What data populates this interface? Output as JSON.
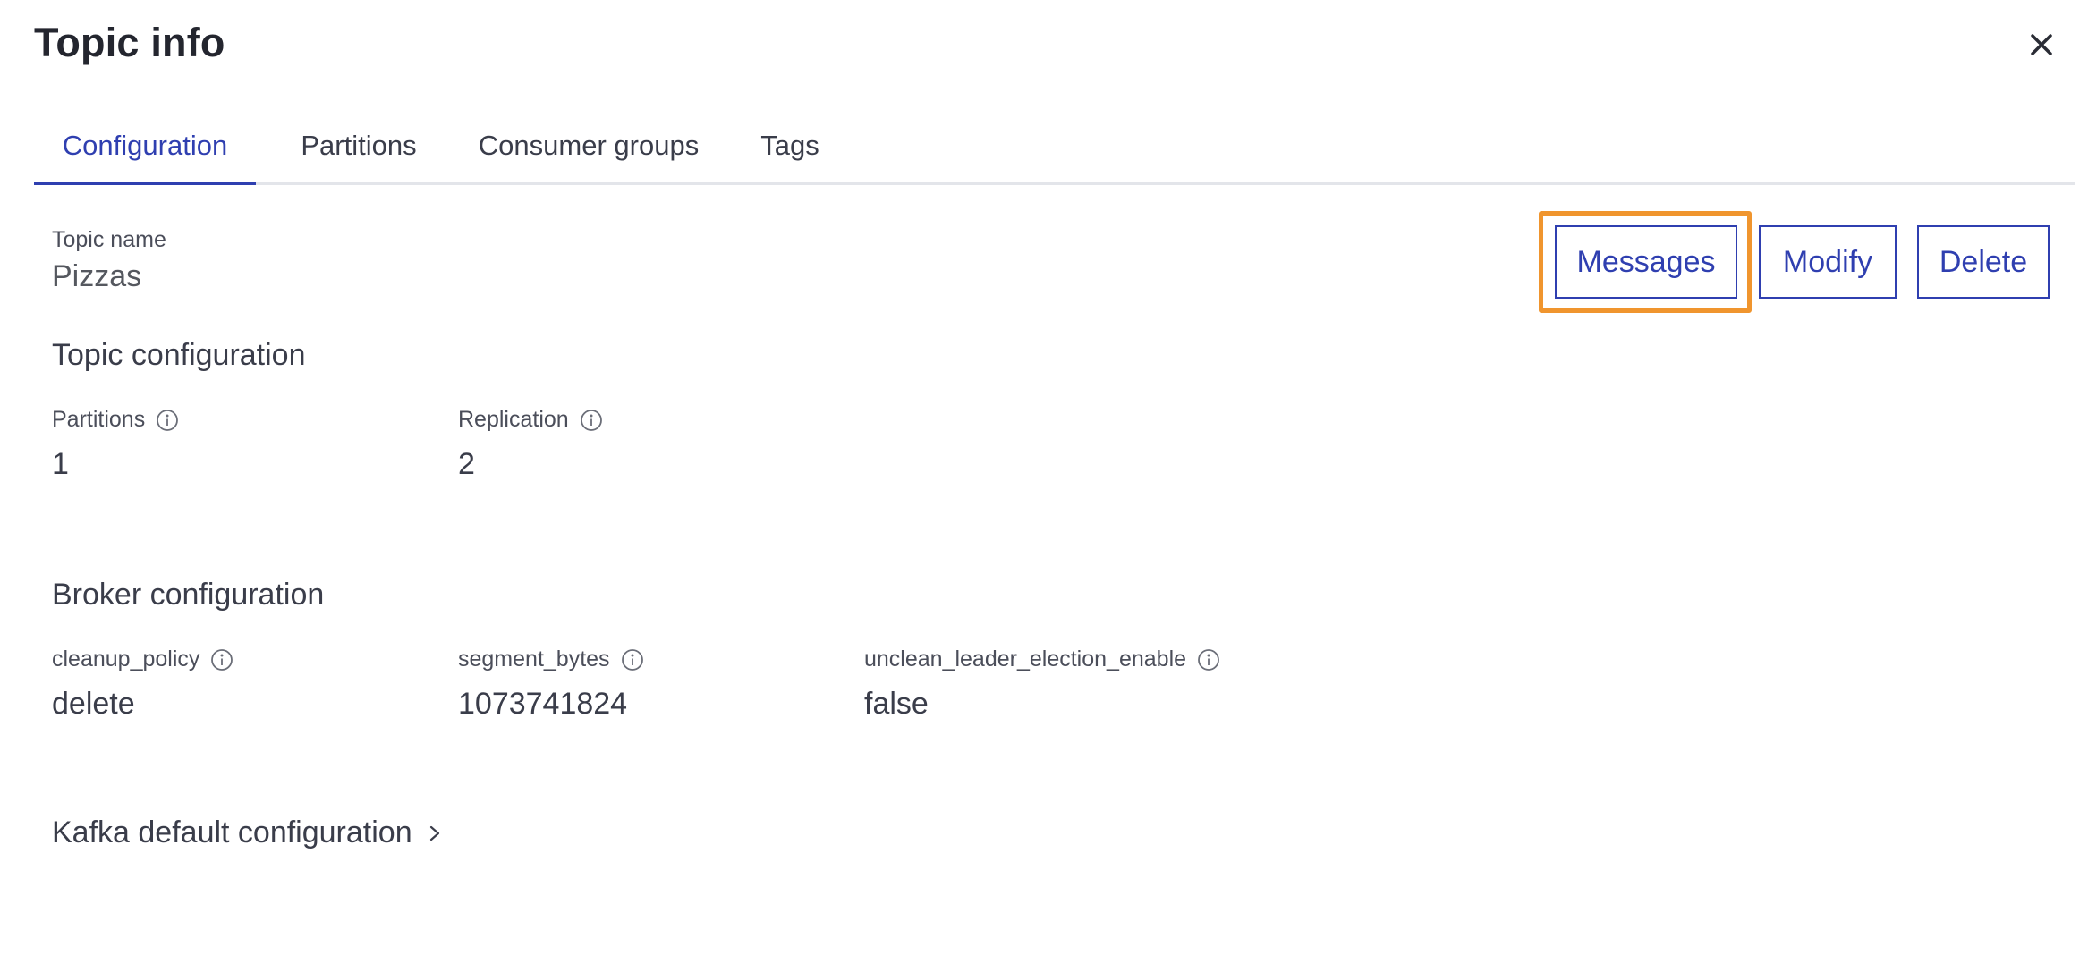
{
  "header": {
    "title": "Topic info",
    "close_icon": "close-icon"
  },
  "tabs": [
    {
      "label": "Configuration",
      "active": true
    },
    {
      "label": "Partitions",
      "active": false
    },
    {
      "label": "Consumer groups",
      "active": false
    },
    {
      "label": "Tags",
      "active": false
    }
  ],
  "topic": {
    "name_label": "Topic name",
    "name_value": "Pizzas"
  },
  "actions": {
    "messages_label": "Messages",
    "modify_label": "Modify",
    "delete_label": "Delete",
    "highlight_color": "#f0952e"
  },
  "topic_config": {
    "title": "Topic configuration",
    "items": [
      {
        "label": "Partitions",
        "value": "1"
      },
      {
        "label": "Replication",
        "value": "2"
      }
    ]
  },
  "broker_config": {
    "title": "Broker configuration",
    "items": [
      {
        "label": "cleanup_policy",
        "value": "delete"
      },
      {
        "label": "segment_bytes",
        "value": "1073741824"
      },
      {
        "label": "unclean_leader_election_enable",
        "value": "false"
      }
    ]
  },
  "kafka_default": {
    "title": "Kafka default configuration",
    "icon": "chevron-right-icon"
  },
  "colors": {
    "accent": "#2f3fb0",
    "text": "#3a3d4a",
    "divider": "#e3e5ea"
  }
}
